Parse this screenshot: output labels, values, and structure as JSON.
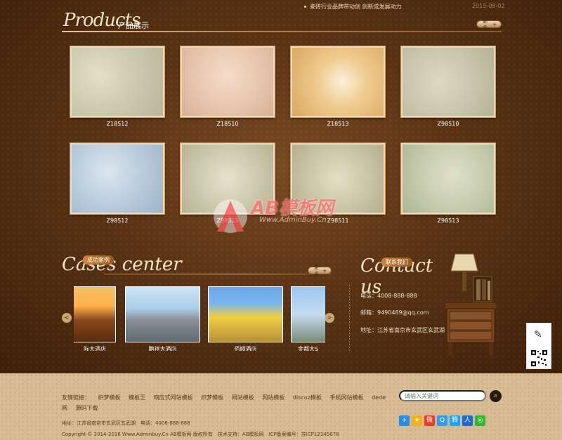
{
  "top_news": {
    "text": "瓷砖行业品牌带动创 创新成发展动力",
    "date": "2015-08-02"
  },
  "products_section": {
    "script_title": "Products",
    "title_cn": "产品展示",
    "more_label": "更多",
    "items": [
      {
        "label": "Z18512"
      },
      {
        "label": "Z18510"
      },
      {
        "label": "Z18513"
      },
      {
        "label": "Z98510"
      },
      {
        "label": "Z98512"
      },
      {
        "label": "Z98513"
      },
      {
        "label": "Z98511"
      },
      {
        "label": "Z98513"
      }
    ]
  },
  "watermark": {
    "title": "AB模板网",
    "sub": "Www.AdminBuy.Cn"
  },
  "cases_section": {
    "script_title": "Cases center",
    "badge": "成功案例",
    "more_label": "更多",
    "prev": "<",
    "next": ">",
    "items": [
      {
        "label": "际大酒店"
      },
      {
        "label": "鹏祥大酒店"
      },
      {
        "label": "佰顺酒店"
      },
      {
        "label": "金都大S"
      }
    ]
  },
  "contact_section": {
    "script_title": "Contact us",
    "badge": "联系我们",
    "phone": "电话：4008-888-888",
    "email": "邮箱：9490489@qq.com",
    "address": "地址：江苏省南京市玄武区玄武湖"
  },
  "side_widget": {
    "edit_icon": "edit-icon"
  },
  "footer": {
    "links": [
      "友情链接：",
      "织梦模板",
      "模板王",
      "响应式网站模板",
      "织梦模板",
      "网站模板",
      "网站模板",
      "discuz模板",
      "手机网站模板",
      "dede网",
      "源码下载"
    ],
    "search_placeholder": "请输入关键词",
    "address": "地址：江苏省南京市玄武区玄武湖　电话：4008-888-888",
    "copyright": "Copyright © 2014-2016 Www.Adminbuy.Cn AB模板网 版权所有　技术支持：AB模板网　ICP备案编号：苏ICP12345678",
    "share_icons": [
      "plus",
      "star",
      "weibo",
      "qzone",
      "tencent",
      "renren",
      "wechat"
    ]
  }
}
